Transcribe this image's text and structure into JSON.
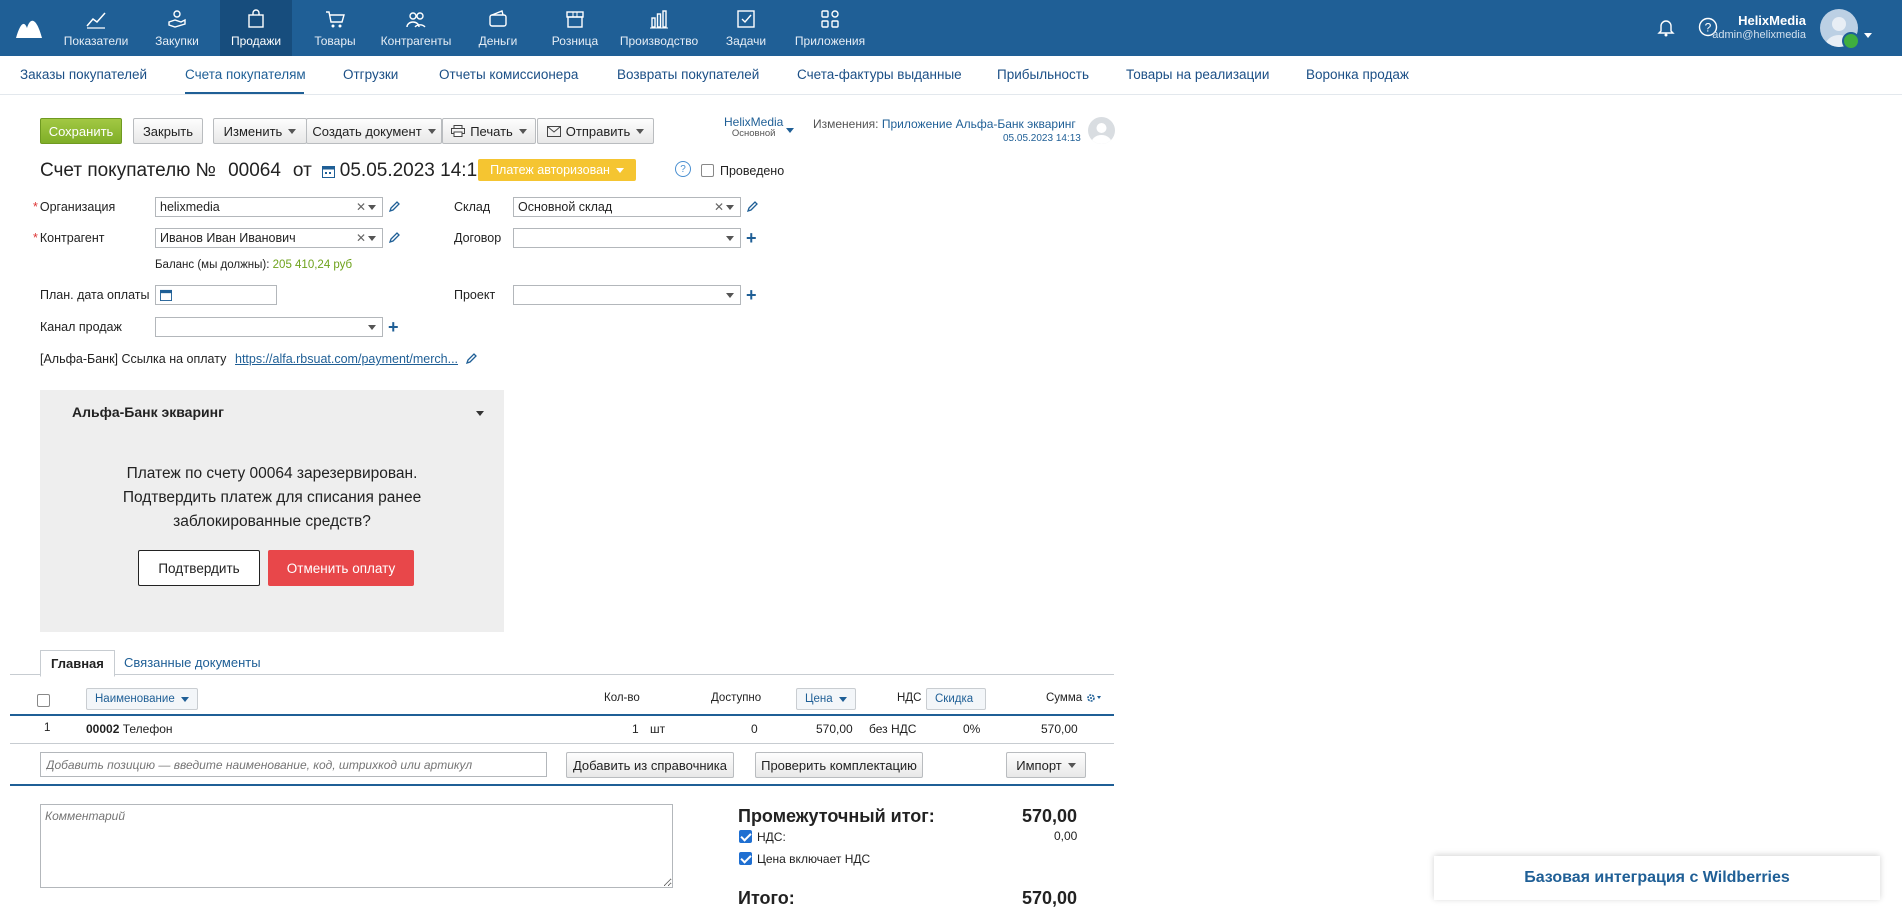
{
  "topnav": {
    "items": [
      {
        "label": "Показатели",
        "icon": "chart-line-icon"
      },
      {
        "label": "Закупки",
        "icon": "hand-coin-icon"
      },
      {
        "label": "Продажи",
        "icon": "shopping-bag-icon",
        "active": true
      },
      {
        "label": "Товары",
        "icon": "cart-icon"
      },
      {
        "label": "Контрагенты",
        "icon": "people-icon"
      },
      {
        "label": "Деньги",
        "icon": "wallet-icon"
      },
      {
        "label": "Розница",
        "icon": "store-icon"
      },
      {
        "label": "Производство",
        "icon": "factory-icon"
      },
      {
        "label": "Задачи",
        "icon": "tasks-icon"
      },
      {
        "label": "Приложения",
        "icon": "apps-icon"
      }
    ],
    "user": {
      "name": "HelixMedia",
      "email": "admin@helixmedia"
    }
  },
  "subnav": {
    "items": [
      "Заказы покупателей",
      "Счета покупателям",
      "Отгрузки",
      "Отчеты комиссионера",
      "Возвраты покупателей",
      "Счета-фактуры выданные",
      "Прибыльность",
      "Товары на реализации",
      "Воронка продаж"
    ],
    "active_index": 1
  },
  "toolbar": {
    "save": "Сохранить",
    "close": "Закрыть",
    "change": "Изменить",
    "create_doc": "Создать документ",
    "print": "Печать",
    "send": "Отправить"
  },
  "owner": {
    "name": "HelixMedia",
    "role": "Основной"
  },
  "changes": {
    "label": "Изменения:",
    "value": "Приложение Альфа-Банк экваринг",
    "date": "05.05.2023 14:13"
  },
  "doc": {
    "title": "Счет покупателю №",
    "number": "00064",
    "from": "от",
    "date": "05.05.2023 14:12",
    "status": "Платеж авторизован",
    "help": "?",
    "posted_label": "Проведено"
  },
  "form": {
    "org_label": "Организация",
    "org_value": "helixmedia",
    "counterparty_label": "Контрагент",
    "counterparty_value": "Иванов Иван Иванович",
    "balance_label": "Баланс (мы должны):",
    "balance_value": "205 410,24 руб",
    "plan_date_label": "План. дата оплаты",
    "channel_label": "Канал продаж",
    "warehouse_label": "Склад",
    "warehouse_value": "Основной склад",
    "contract_label": "Договор",
    "project_label": "Проект",
    "payment_link_label": "[Альфа-Банк] Ссылка на оплату",
    "payment_link_value": "https://alfa.rbsuat.com/payment/merch..."
  },
  "alfa_panel": {
    "title": "Альфа-Банк экваринг",
    "message_lines": [
      "Платеж по счету 00064 зарезервирован.",
      "Подтвердить платеж для списания ранее",
      "заблокированные средств?"
    ],
    "confirm": "Подтвердить",
    "cancel": "Отменить оплату"
  },
  "tabs": [
    "Главная",
    "Связанные документы"
  ],
  "table": {
    "headers": {
      "name": "Наименование",
      "qty": "Кол-во",
      "available": "Доступно",
      "price": "Цена",
      "vat": "НДС",
      "discount": "Скидка",
      "sum": "Сумма"
    },
    "rows": [
      {
        "index": "1",
        "code": "00002",
        "name": "Телефон",
        "qty": "1",
        "unit": "шт",
        "available": "0",
        "price": "570,00",
        "vat": "без НДС",
        "discount": "0%",
        "sum": "570,00"
      }
    ],
    "add_placeholder": "Добавить позицию — введите наименование, код, штрихкод или артикул",
    "add_from_catalog": "Добавить из справочника",
    "check_kit": "Проверить комплектацию",
    "import": "Импорт"
  },
  "comment_placeholder": "Комментарий",
  "totals": {
    "subtotal_label": "Промежуточный итог:",
    "subtotal_value": "570,00",
    "vat_label": "НДС:",
    "vat_value": "0,00",
    "price_includes_vat": "Цена включает НДС",
    "total_label": "Итого:",
    "total_value": "570,00"
  },
  "promo": {
    "label": "Базовая интеграция с Wildberries"
  }
}
